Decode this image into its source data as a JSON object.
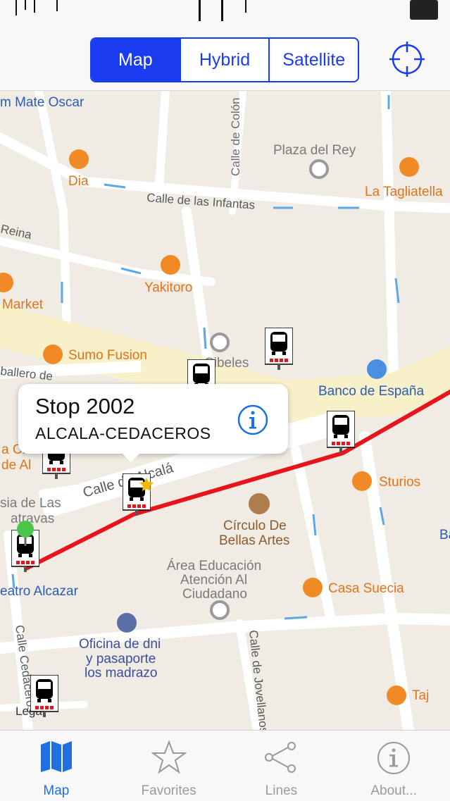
{
  "header": {
    "map_types": [
      "Map",
      "Hybrid",
      "Satellite"
    ],
    "selected_map_type": "Map"
  },
  "map": {
    "labels": {
      "mate_oscar": "m Mate Oscar",
      "plaza_rey": "Plaza del Rey",
      "calle_colon": "Calle de Colón",
      "dia": "Dia",
      "tagliatella": "La Tagliatella",
      "infantas": "Calle de las Infantas",
      "reina": "Reina",
      "yakitoro": "Yakitoro",
      "market": "Market",
      "sumo": "Sumo Fusion",
      "cibeles": "Cibeles",
      "caballero": "ballero de",
      "banco": "Banco de España",
      "la_cha": "a Cha",
      "de_al": "de Al",
      "sia_de_las": "sia de Las",
      "atravas": "atravas",
      "calle_alcala": "Calle de Alcalá",
      "sturios": "Sturios",
      "circulo": [
        "Círculo De",
        "Bellas Artes"
      ],
      "area": [
        "Área Educación",
        "Atención Al",
        "Ciudadano"
      ],
      "teatro": "eatro Alcazar",
      "casa_suecia": "Casa Suecia",
      "ba": "Ba",
      "oficina": [
        "Oficina de dni",
        "y pasaporte",
        "los madrazo"
      ],
      "cedaceros": "Calle Cedaceros",
      "jovellanos": "Calle de Jovellanos",
      "taj": "Taj",
      "legal": "Legal"
    }
  },
  "callout": {
    "title": "Stop 2002",
    "subtitle": "ALCALA-CEDACEROS"
  },
  "tabs": [
    {
      "label": "Map",
      "icon": "map-icon"
    },
    {
      "label": "Favorites",
      "icon": "star-icon"
    },
    {
      "label": "Lines",
      "icon": "share-icon"
    },
    {
      "label": "About...",
      "icon": "info-icon"
    }
  ],
  "colors": {
    "accent": "#1a3cf0",
    "route": "#e8141c",
    "tab_active": "#1f6fe0",
    "map_bg": "#f0ece3",
    "road": "#ffffff",
    "main_road": "#f8f0c8",
    "poi_orange": "#f08a24",
    "poi_gray": "#8c8c8c",
    "label_blue": "#2a5cb8"
  }
}
